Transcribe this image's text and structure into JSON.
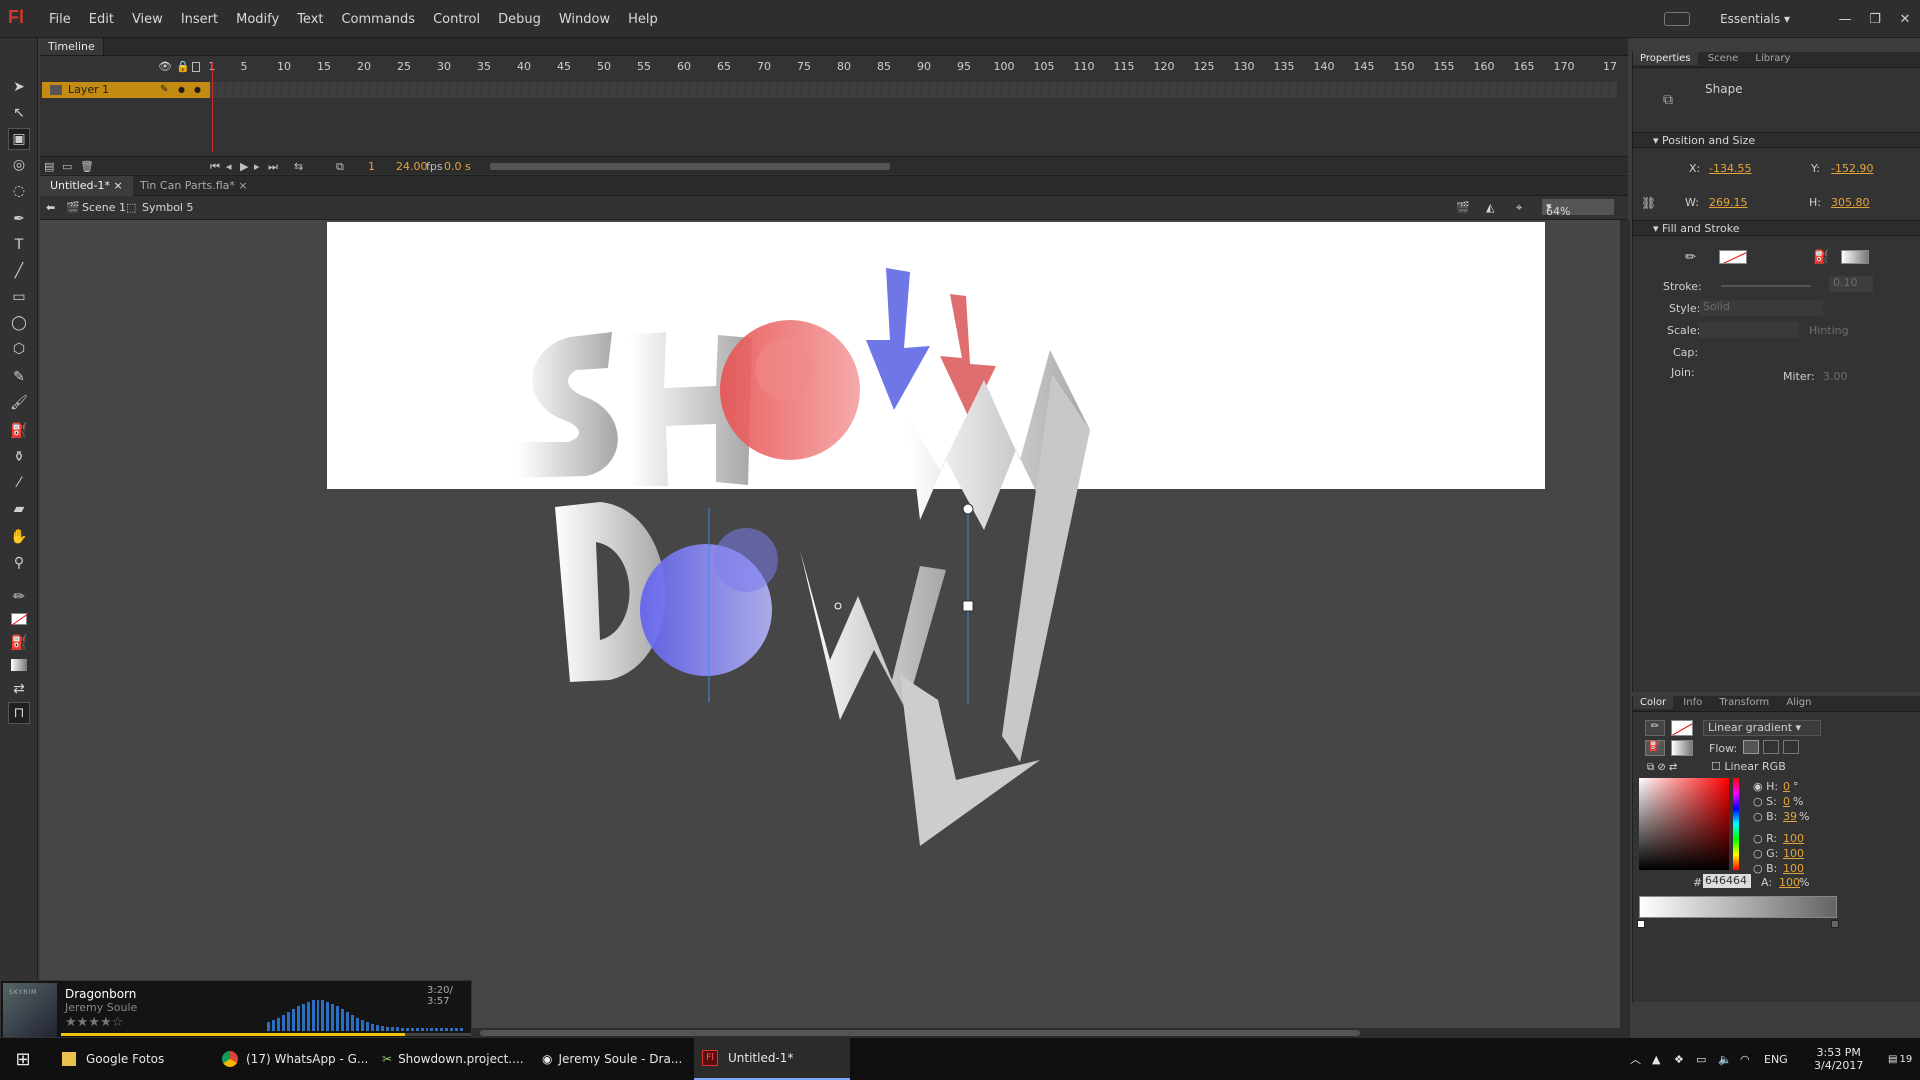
{
  "app": {
    "logo": "Fl",
    "menus": [
      "File",
      "Edit",
      "View",
      "Insert",
      "Modify",
      "Text",
      "Commands",
      "Control",
      "Debug",
      "Window",
      "Help"
    ],
    "workspace": "Essentials"
  },
  "timeline": {
    "title": "Timeline",
    "ruler": [
      "1",
      "5",
      "10",
      "15",
      "20",
      "25",
      "30",
      "35",
      "40",
      "45",
      "50",
      "55",
      "60",
      "65",
      "70",
      "75",
      "80",
      "85",
      "90",
      "95",
      "100",
      "105",
      "110",
      "115",
      "120",
      "125",
      "130",
      "135",
      "140",
      "145",
      "150",
      "155",
      "160",
      "165",
      "170",
      "17"
    ],
    "layer_name": "Layer 1",
    "current_frame": "1",
    "fps": "24.00",
    "fps_unit": "fps",
    "time": "0.0 s"
  },
  "documents": {
    "tabs": [
      "Untitled-1*",
      "Tin Can Parts.fla*"
    ],
    "close": "×"
  },
  "editbar": {
    "scene": "Scene 1",
    "symbol": "Symbol 5",
    "zoom": "64%"
  },
  "properties": {
    "tabs": [
      "Properties",
      "Scene",
      "Library"
    ],
    "type": "Shape",
    "position_header": "Position and Size",
    "x_label": "X:",
    "x": "-134.55",
    "y_label": "Y:",
    "y": "-152.90",
    "w_label": "W:",
    "w": "269.15",
    "h_label": "H:",
    "h": "305.80",
    "fill_header": "Fill and Stroke",
    "stroke_label": "Stroke:",
    "stroke_value": "0.10",
    "style_label": "Style:",
    "style_value": "Solid",
    "scale_label": "Scale:",
    "hinting": "Hinting",
    "cap_label": "Cap:",
    "join_label": "Join:",
    "miter_label": "Miter:",
    "miter": "3.00"
  },
  "color": {
    "tabs": [
      "Color",
      "Info",
      "Transform",
      "Align"
    ],
    "fill_type": "Linear gradient",
    "flow_label": "Flow:",
    "linear_rgb": "Linear RGB",
    "h_label": "H:",
    "h": "0",
    "h_unit": "°",
    "s_label": "S:",
    "s": "0",
    "s_unit": "%",
    "b_label": "B:",
    "b": "39",
    "b_unit": "%",
    "r_label": "R:",
    "r": "100",
    "g_label": "G:",
    "g": "100",
    "bb_label": "B:",
    "bb": "100",
    "hex_label": "#",
    "hex": "646464",
    "a_label": "A:",
    "a": "100",
    "a_unit": "%"
  },
  "music": {
    "album": "SKYRIM",
    "title": "Dragonborn",
    "artist": "Jeremy Soule",
    "time": "3:20/ 3:57",
    "rating": "★★★★☆"
  },
  "taskbar": {
    "items": [
      "Google Fotos",
      "(17) WhatsApp - G...",
      "Showdown.project....",
      "Jeremy Soule - Dra...",
      "Untitled-1*"
    ],
    "lang": "ENG",
    "time": "3:53 PM",
    "date": "3/4/2017",
    "notif": "19"
  },
  "colors": {
    "accent_orange": "#e4a33a",
    "stage_bg": "#464646",
    "red_circle": "#f07070",
    "blue_circle": "#7070ee"
  }
}
